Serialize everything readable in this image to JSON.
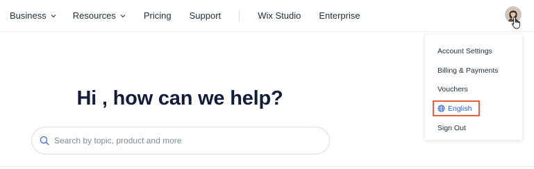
{
  "nav": {
    "items": [
      {
        "label": "Business",
        "has_caret": true
      },
      {
        "label": "Resources",
        "has_caret": true
      },
      {
        "label": "Pricing",
        "has_caret": false
      },
      {
        "label": "Support",
        "has_caret": false
      },
      {
        "label": "Wix Studio",
        "has_caret": false
      },
      {
        "label": "Enterprise",
        "has_caret": false
      }
    ],
    "caret_icon": "chevron-down-icon"
  },
  "hero": {
    "title": "Hi , how can we help?"
  },
  "search": {
    "placeholder": "Search by topic, product and more",
    "value": "",
    "icon": "search-icon"
  },
  "account_menu": {
    "avatar_icon": "user-avatar",
    "cursor_icon": "hand-pointer-icon",
    "items": [
      {
        "label": "Account Settings"
      },
      {
        "label": "Billing & Payments"
      },
      {
        "label": "Vouchers"
      },
      {
        "label": "English",
        "icon": "globe-icon",
        "highlighted": true
      },
      {
        "label": "Sign Out"
      }
    ]
  },
  "colors": {
    "text": "#20303c",
    "title": "#131c3a",
    "link_blue": "#2e62d6",
    "highlight_border": "#e65f3e",
    "placeholder": "#7f8b96"
  }
}
